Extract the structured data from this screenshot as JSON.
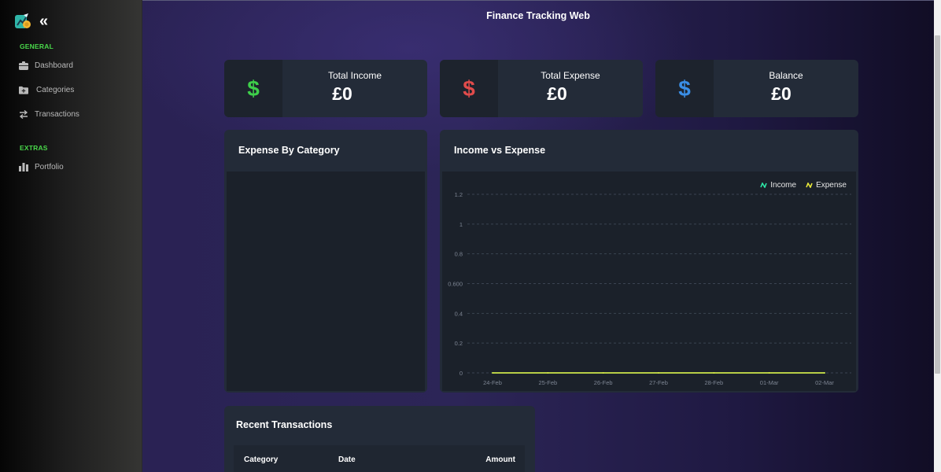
{
  "app": {
    "title": "Finance Tracking Web"
  },
  "sidebar": {
    "sections": [
      {
        "title": "GENERAL",
        "items": [
          {
            "label": "Dashboard",
            "icon": "dashboard-icon"
          },
          {
            "label": "Categories",
            "icon": "folder-plus-icon"
          },
          {
            "label": "Transactions",
            "icon": "arrows-exchange-icon"
          }
        ]
      },
      {
        "title": "EXTRAS",
        "items": [
          {
            "label": "Portfolio",
            "icon": "bar-chart-icon"
          }
        ]
      }
    ]
  },
  "stats": [
    {
      "label": "Total Income",
      "value": "£0",
      "icon": "dollar-icon",
      "color": "#3ecf4a"
    },
    {
      "label": "Total Expense",
      "value": "£0",
      "icon": "dollar-icon",
      "color": "#e04b4b"
    },
    {
      "label": "Balance",
      "value": "£0",
      "icon": "dollar-icon",
      "color": "#3a8ee6"
    }
  ],
  "expense_by_category": {
    "title": "Expense By Category"
  },
  "income_vs_expense": {
    "title": "Income vs Expense"
  },
  "chart_data": {
    "type": "line",
    "title": "Income vs Expense",
    "categories": [
      "24-Feb",
      "25-Feb",
      "26-Feb",
      "27-Feb",
      "28-Feb",
      "01-Mar",
      "02-Mar"
    ],
    "y_ticks": [
      "0",
      "0.2",
      "0.4",
      "0.600",
      "0.8",
      "1",
      "1.2"
    ],
    "ylim": [
      0,
      1.2
    ],
    "grid": true,
    "legend_position": "top-right",
    "series": [
      {
        "name": "Income",
        "values": [
          0,
          0,
          0,
          0,
          0,
          0,
          0
        ],
        "color": "#2ee6a6"
      },
      {
        "name": "Expense",
        "values": [
          0,
          0,
          0,
          0,
          0,
          0,
          0
        ],
        "color": "#e8e83a"
      }
    ]
  },
  "recent_transactions": {
    "title": "Recent Transactions",
    "columns": [
      "Category",
      "Date",
      "Amount"
    ]
  }
}
